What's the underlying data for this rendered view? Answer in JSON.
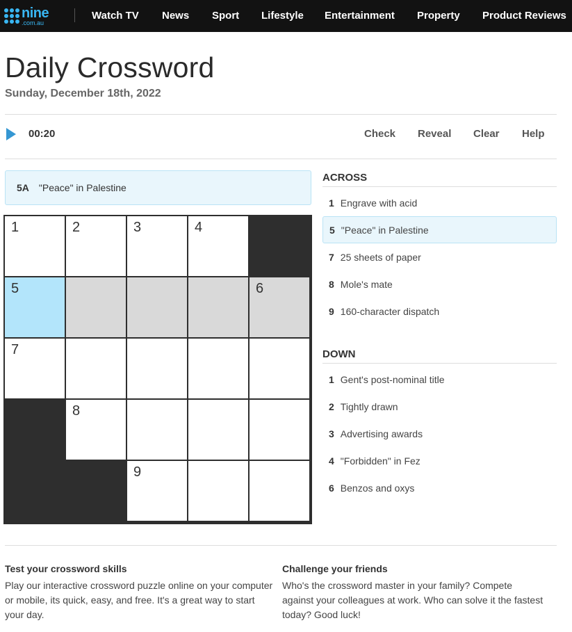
{
  "nav": {
    "logo": {
      "brand": "nine",
      "domain": ".com.au",
      "color": "#39b6f2"
    },
    "items": [
      "Watch TV",
      "News",
      "Sport",
      "Lifestyle",
      "Entertainment",
      "Property",
      "Product Reviews"
    ]
  },
  "header": {
    "title": "Daily Crossword",
    "date": "Sunday, December 18th, 2022"
  },
  "toolbar": {
    "timer": "00:20",
    "check": "Check",
    "reveal": "Reveal",
    "clear": "Clear",
    "help": "Help"
  },
  "current_clue": {
    "num": "5A",
    "text": "\"Peace\" in Palestine"
  },
  "grid": {
    "rows": 5,
    "cols": 5,
    "cells": [
      [
        "1",
        "2",
        "3",
        "4",
        "#"
      ],
      [
        "5",
        "",
        "",
        "",
        "6"
      ],
      [
        "7",
        "",
        "",
        "",
        ""
      ],
      [
        "#",
        "8",
        "",
        "",
        ""
      ],
      [
        "#",
        "#",
        "9",
        "",
        ""
      ]
    ],
    "active": [
      1,
      0
    ],
    "highlighted_row": 1
  },
  "across": {
    "heading": "ACROSS",
    "clues": [
      {
        "num": "1",
        "text": "Engrave with acid"
      },
      {
        "num": "5",
        "text": "\"Peace\" in Palestine",
        "selected": true
      },
      {
        "num": "7",
        "text": "25 sheets of paper"
      },
      {
        "num": "8",
        "text": "Mole's mate"
      },
      {
        "num": "9",
        "text": "160-character dispatch"
      }
    ]
  },
  "down": {
    "heading": "DOWN",
    "clues": [
      {
        "num": "1",
        "text": "Gent's post-nominal title"
      },
      {
        "num": "2",
        "text": "Tightly drawn"
      },
      {
        "num": "3",
        "text": "Advertising awards"
      },
      {
        "num": "4",
        "text": "\"Forbidden\" in Fez"
      },
      {
        "num": "6",
        "text": "Benzos and oxys"
      }
    ]
  },
  "footer": {
    "left_title": "Test your crossword skills",
    "left_body": "Play our interactive crossword puzzle online on your computer or mobile, its quick, easy, and free. It's a great way to start your day.",
    "right_title": "Challenge your friends",
    "right_body": "Who's the crossword master in your family? Compete against your colleagues at work. Who can solve it the fastest today? Good luck!"
  },
  "colors": {
    "accent": "#3597d3",
    "active_cell": "#b3e5fb",
    "highlight_cell": "#d9d9d9",
    "black_cell": "#2e2e2e",
    "selected_clue_bg": "#e9f6fc"
  }
}
